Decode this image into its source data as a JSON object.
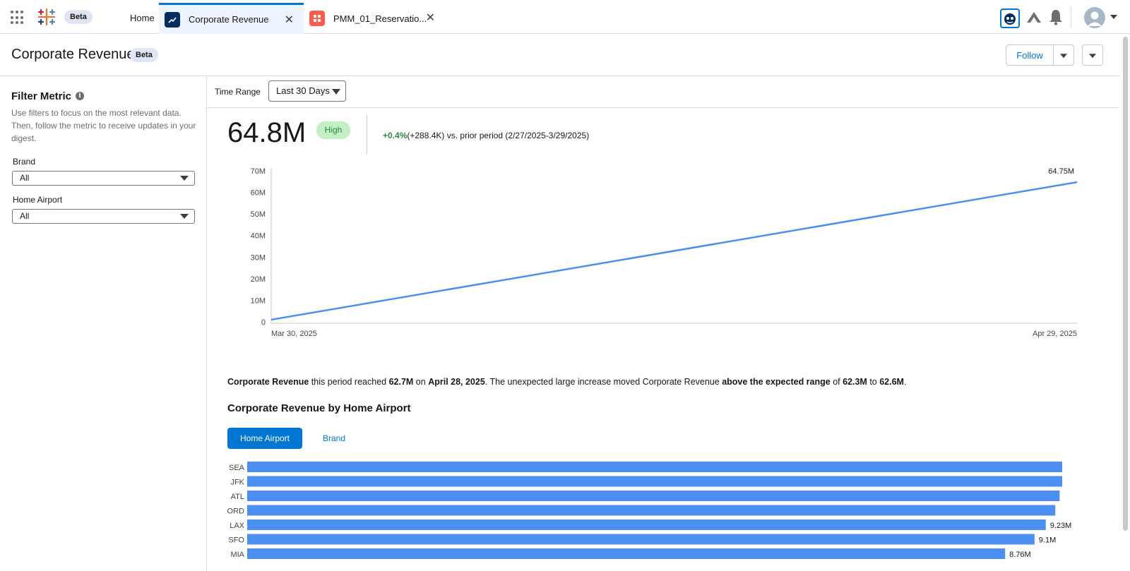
{
  "topnav": {
    "beta": "Beta",
    "home": "Home",
    "tabs": [
      {
        "label": "Corporate Revenue",
        "icon": "metric-trend-icon",
        "color": "#032d60"
      },
      {
        "label": "PMM_01_Reservatio...",
        "icon": "dashboard-icon",
        "color": "#fe5c4c"
      }
    ]
  },
  "header": {
    "title": "Corporate Revenue",
    "beta": "Beta",
    "follow": "Follow"
  },
  "sidebar": {
    "title": "Filter Metric",
    "description": "Use filters to focus on the most relevant data. Then, follow the metric to receive updates in your digest.",
    "filters": [
      {
        "label": "Brand",
        "value": "All"
      },
      {
        "label": "Home Airport",
        "value": "All"
      }
    ]
  },
  "main": {
    "time_range_label": "Time Range",
    "time_range_value": "Last 30 Days",
    "value": "64.8M",
    "badge": "High",
    "change_pct": "+0.4%",
    "change_detail": "(+288.4K) vs. prior period (2/27/2025-3/29/2025)",
    "insight": {
      "p1": "Corporate Revenue",
      "p2": " this period reached ",
      "p3": "62.7M",
      "p4": " on ",
      "p5": "April 28, 2025",
      "p6": ". The unexpected large increase moved Corporate Revenue ",
      "p7": "above the expected range",
      "p8": " of ",
      "p9": "62.3M",
      "p10": " to ",
      "p11": "62.6M",
      "p12": "."
    },
    "section_title": "Corporate Revenue by Home Airport",
    "segments": [
      "Home Airport",
      "Brand"
    ]
  },
  "chart_data": [
    {
      "type": "line",
      "x": [
        "Mar 30, 2025",
        "Apr 29, 2025"
      ],
      "values": [
        1,
        64.75
      ],
      "end_label": "64.75M",
      "ylim": [
        0,
        70
      ],
      "yticks": [
        "0",
        "10M",
        "20M",
        "30M",
        "40M",
        "50M",
        "60M",
        "70M"
      ],
      "xticks": [
        "Mar 30, 2025",
        "Apr 29, 2025"
      ],
      "color": "#4b8ff0"
    },
    {
      "type": "bar",
      "orientation": "horizontal",
      "categories": [
        "SEA",
        "JFK",
        "ATL",
        "ORD",
        "LAX",
        "SFO",
        "MIA"
      ],
      "values": [
        9.42,
        9.42,
        9.39,
        9.34,
        9.23,
        9.1,
        8.76
      ],
      "labels": [
        "",
        "",
        "",
        "",
        "9.23M",
        "9.1M",
        "8.76M"
      ],
      "color": "#4b8ff0"
    }
  ]
}
